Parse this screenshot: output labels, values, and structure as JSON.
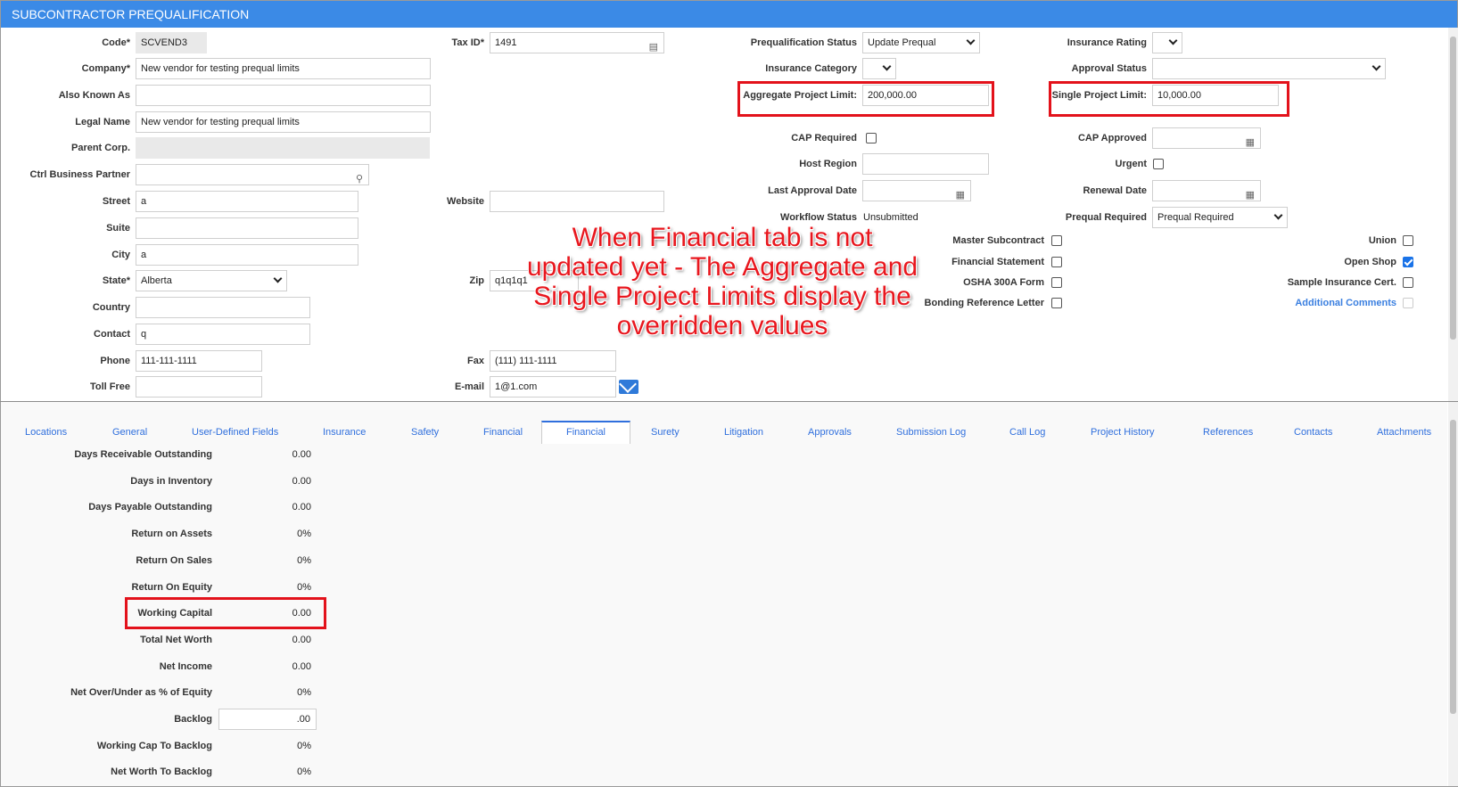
{
  "title": "SUBCONTRACTOR PREQUALIFICATION",
  "left_fields": {
    "code": {
      "label": "Code*",
      "value": "SCVEND3"
    },
    "company": {
      "label": "Company*",
      "value": "New vendor for testing prequal limits"
    },
    "aka": {
      "label": "Also Known As",
      "value": ""
    },
    "legal": {
      "label": "Legal Name",
      "value": "New vendor for testing prequal limits"
    },
    "parent": {
      "label": "Parent Corp.",
      "value": ""
    },
    "ctrl": {
      "label": "Ctrl Business Partner",
      "value": ""
    },
    "street": {
      "label": "Street",
      "value": "a"
    },
    "suite": {
      "label": "Suite",
      "value": ""
    },
    "city": {
      "label": "City",
      "value": "a"
    },
    "state": {
      "label": "State*",
      "value": "Alberta"
    },
    "country": {
      "label": "Country",
      "value": ""
    },
    "contact": {
      "label": "Contact",
      "value": "q"
    },
    "phone": {
      "label": "Phone",
      "value": "111-111-1111"
    },
    "tollfree": {
      "label": "Toll Free",
      "value": ""
    }
  },
  "middle_fields": {
    "taxid": {
      "label": "Tax ID*",
      "value": "1491"
    },
    "website": {
      "label": "Website",
      "value": ""
    },
    "zip": {
      "label": "Zip",
      "value": "q1q1q1"
    },
    "fax": {
      "label": "Fax",
      "value": "(111) 111-1111"
    },
    "email": {
      "label": "E-mail",
      "value": "1@1.com"
    }
  },
  "right_fields": {
    "prequal_status": {
      "label": "Prequalification Status",
      "value": "Update Prequal"
    },
    "ins_category": {
      "label": "Insurance Category",
      "value": ""
    },
    "agg_limit": {
      "label": "Aggregate Project Limit:",
      "value": "200,000.00"
    },
    "cap_required": {
      "label": "CAP Required"
    },
    "host_region": {
      "label": "Host Region",
      "value": ""
    },
    "last_approval": {
      "label": "Last Approval Date",
      "value": ""
    },
    "workflow": {
      "label": "Workflow Status",
      "value": "Unsubmitted"
    },
    "ins_rating": {
      "label": "Insurance Rating",
      "value": ""
    },
    "approval_status": {
      "label": "Approval Status",
      "value": ""
    },
    "single_limit": {
      "label": "Single Project Limit:",
      "value": "10,000.00"
    },
    "cap_approved": {
      "label": "CAP Approved",
      "value": ""
    },
    "urgent": {
      "label": "Urgent"
    },
    "renewal": {
      "label": "Renewal Date",
      "value": ""
    },
    "prequal_required": {
      "label": "Prequal Required",
      "value": "Prequal Required"
    }
  },
  "checkboxes": {
    "master_sub": "Master Subcontract",
    "fin_statement": "Financial Statement",
    "osha": "OSHA 300A Form",
    "bonding": "Bonding Reference Letter",
    "union": "Union",
    "open_shop": "Open Shop",
    "sample_ins": "Sample Insurance Cert.",
    "add_comments": "Additional Comments"
  },
  "annotation": "When Financial tab is not updated yet - The Aggregate and Single Project Limits display the overridden values",
  "tabs": [
    "Locations",
    "General",
    "User-Defined Fields",
    "Insurance",
    "Safety",
    "Financial",
    "Financial",
    "Surety",
    "Litigation",
    "Approvals",
    "Submission Log",
    "Call Log",
    "Project History",
    "References",
    "Contacts",
    "Attachments"
  ],
  "financial": [
    {
      "label": "Days Receivable Outstanding",
      "value": "0.00"
    },
    {
      "label": "Days in Inventory",
      "value": "0.00"
    },
    {
      "label": "Days Payable Outstanding",
      "value": "0.00"
    },
    {
      "label": "Return on Assets",
      "value": "0%"
    },
    {
      "label": "Return On Sales",
      "value": "0%"
    },
    {
      "label": "Return On Equity",
      "value": "0%"
    },
    {
      "label": "Working Capital",
      "value": "0.00"
    },
    {
      "label": "Total Net Worth",
      "value": "0.00"
    },
    {
      "label": "Net Income",
      "value": "0.00"
    },
    {
      "label": "Net Over/Under as % of Equity",
      "value": "0%"
    },
    {
      "label": "Backlog",
      "value": ".00"
    },
    {
      "label": "Working Cap To Backlog",
      "value": "0%"
    },
    {
      "label": "Net Worth To Backlog",
      "value": "0%"
    }
  ]
}
